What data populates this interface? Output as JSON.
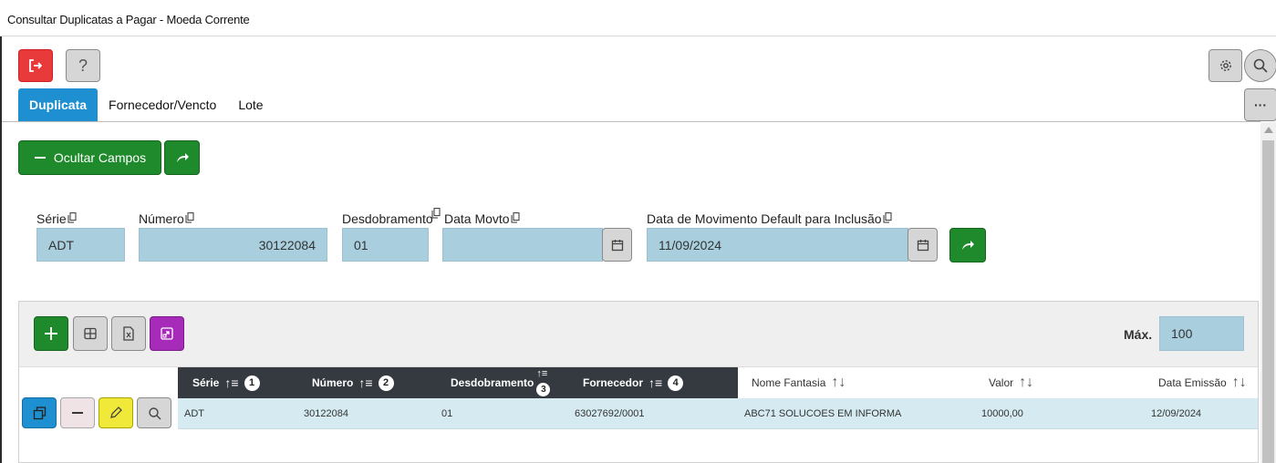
{
  "window": {
    "title": "Consultar Duplicatas a Pagar - Moeda Corrente"
  },
  "toolbar": {
    "exit": "exit-icon",
    "help": "?",
    "settings": "gear-icon",
    "search": "search-icon",
    "more": "···"
  },
  "tabs": [
    {
      "label": "Duplicata",
      "active": true
    },
    {
      "label": "Fornecedor/Vencto",
      "active": false
    },
    {
      "label": "Lote",
      "active": false
    }
  ],
  "actions": {
    "hide_fields": "Ocultar Campos"
  },
  "form": {
    "serie": {
      "label": "Série",
      "value": "ADT"
    },
    "numero": {
      "label": "Número",
      "value": "30122084"
    },
    "desdobramento": {
      "label": "Desdobramento",
      "value": "01"
    },
    "data_movto": {
      "label": "Data Movto",
      "value": ""
    },
    "data_default": {
      "label": "Data de Movimento Default para Inclusão",
      "value": "11/09/2024"
    }
  },
  "grid": {
    "max_label": "Máx.",
    "max_value": "100",
    "columns": [
      {
        "label": "Série",
        "order": "1"
      },
      {
        "label": "Número",
        "order": "2"
      },
      {
        "label": "Desdobramento",
        "order": "3"
      },
      {
        "label": "Fornecedor",
        "order": "4"
      },
      {
        "label": "Nome Fantasia",
        "order": ""
      },
      {
        "label": "Valor",
        "order": ""
      },
      {
        "label": "Data Emissão",
        "order": ""
      }
    ],
    "rows": [
      {
        "serie": "ADT",
        "numero": "30122084",
        "desdobramento": "01",
        "fornecedor": "63027692/0001",
        "nome_fantasia": "ABC71 SOLUCOES EM INFORMA",
        "valor": "10000,00",
        "data_emissao": "12/09/2024"
      }
    ]
  },
  "colors": {
    "primary": "#1e8fd1",
    "success": "#1f8a2b",
    "danger": "#e8393b",
    "warning": "#f0e93a",
    "purple": "#a52bb8",
    "input_bg": "#a9cfdf",
    "header_dark": "#343a40"
  }
}
